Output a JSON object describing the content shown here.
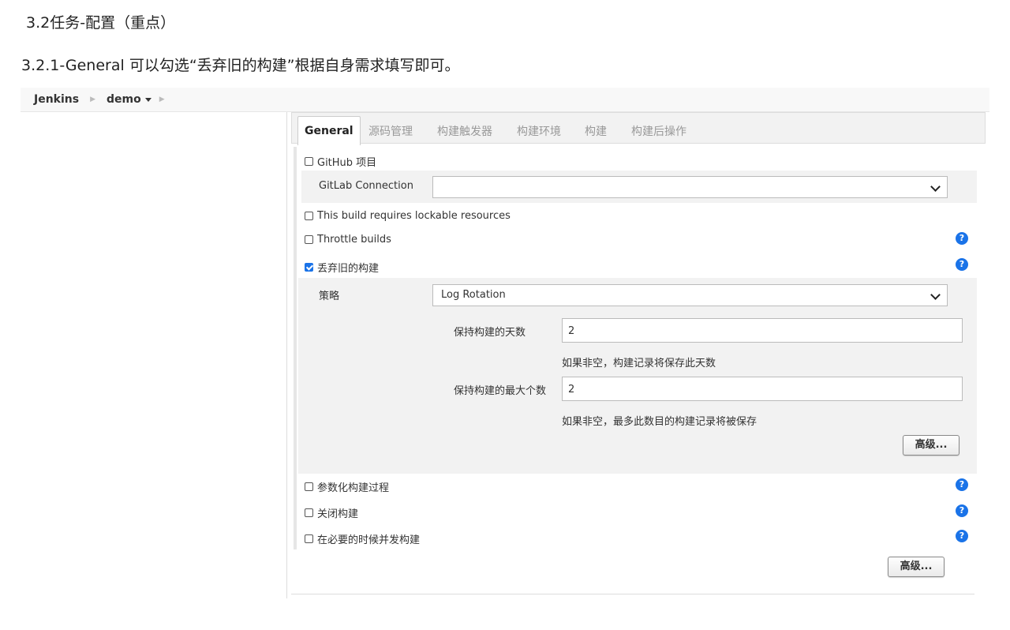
{
  "doc": {
    "heading": "3.2任务-配置（重点）",
    "subheading": "3.2.1-General 可以勾选“丢弃旧的构建”根据自身需求填写即可。"
  },
  "breadcrumb": {
    "root": "Jenkins",
    "job": "demo"
  },
  "tabs": [
    {
      "label": "General",
      "active": true
    },
    {
      "label": "源码管理",
      "active": false
    },
    {
      "label": "构建触发器",
      "active": false
    },
    {
      "label": "构建环境",
      "active": false
    },
    {
      "label": "构建",
      "active": false
    },
    {
      "label": "构建后操作",
      "active": false
    }
  ],
  "general": {
    "github_project": {
      "label": "GitHub 项目",
      "checked": false
    },
    "gitlab_connection": {
      "label": "GitLab Connection",
      "value": ""
    },
    "lockable_resources": {
      "label": "This build requires lockable resources",
      "checked": false
    },
    "throttle_builds": {
      "label": "Throttle builds",
      "checked": false
    },
    "discard_old_builds": {
      "label": "丢弃旧的构建",
      "checked": true,
      "strategy_label": "策略",
      "strategy_value": "Log Rotation",
      "days_label": "保持构建的天数",
      "days_value": "2",
      "days_hint": "如果非空，构建记录将保存此天数",
      "max_label": "保持构建的最大个数",
      "max_value": "2",
      "max_hint": "如果非空，最多此数目的构建记录将被保存",
      "advanced_label": "高级..."
    },
    "parameterized": {
      "label": "参数化构建过程",
      "checked": false
    },
    "disable_build": {
      "label": "关闭构建",
      "checked": false
    },
    "concurrent": {
      "label": "在必要的时候并发构建",
      "checked": false
    },
    "advanced_label": "高级..."
  },
  "icons": {
    "help": "help-icon",
    "help_glyph": "?",
    "help_color": "#1a73e8"
  }
}
